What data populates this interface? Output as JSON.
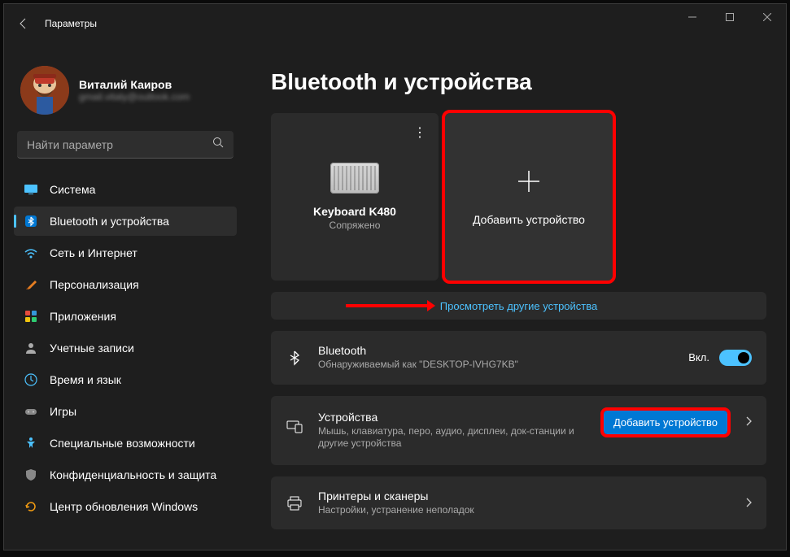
{
  "window": {
    "title": "Параметры"
  },
  "user": {
    "name": "Виталий Каиров",
    "email": "gmail.vitaly@outlook.com"
  },
  "search": {
    "placeholder": "Найти параметр"
  },
  "nav": [
    {
      "label": "Система"
    },
    {
      "label": "Bluetooth и устройства"
    },
    {
      "label": "Сеть и Интернет"
    },
    {
      "label": "Персонализация"
    },
    {
      "label": "Приложения"
    },
    {
      "label": "Учетные записи"
    },
    {
      "label": "Время и язык"
    },
    {
      "label": "Игры"
    },
    {
      "label": "Специальные возможности"
    },
    {
      "label": "Конфиденциальность и защита"
    },
    {
      "label": "Центр обновления Windows"
    }
  ],
  "page": {
    "title": "Bluetooth и устройства"
  },
  "device_tile": {
    "name": "Keyboard K480",
    "status": "Сопряжено"
  },
  "add_tile": {
    "label": "Добавить устройство"
  },
  "view_more": {
    "label": "Просмотреть другие устройства"
  },
  "bluetooth_card": {
    "title": "Bluetooth",
    "subtitle": "Обнаруживаемый как \"DESKTOP-IVHG7KB\"",
    "toggle_label": "Вкл."
  },
  "devices_card": {
    "title": "Устройства",
    "subtitle": "Мышь, клавиатура, перо, аудио, дисплеи, док-станции и другие устройства",
    "button": "Добавить устройство"
  },
  "printers_card": {
    "title": "Принтеры и сканеры",
    "subtitle": "Настройки, устранение неполадок"
  }
}
